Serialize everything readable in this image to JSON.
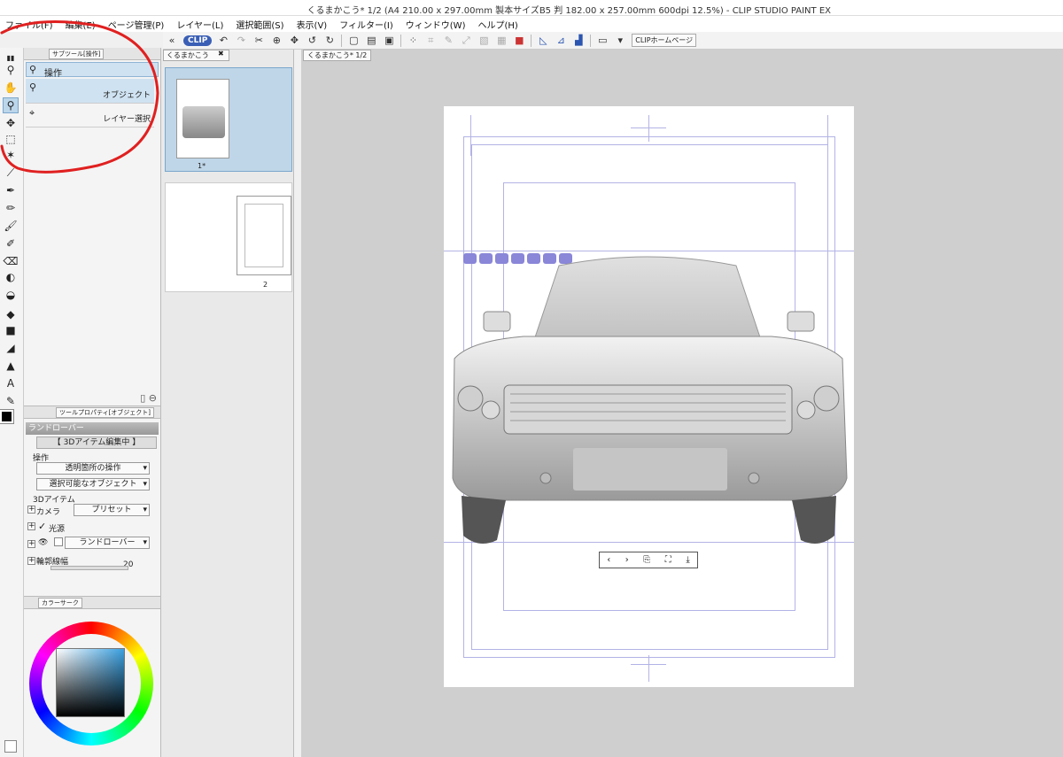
{
  "window": {
    "title": "くるまかこう* 1/2 (A4 210.00 x 297.00mm 製本サイズB5 判 182.00 x 257.00mm 600dpi 12.5%) - CLIP STUDIO PAINT EX"
  },
  "menu": [
    "ファイル(F)",
    "編集(E)",
    "ページ管理(P)",
    "レイヤー(L)",
    "選択範囲(S)",
    "表示(V)",
    "フィルター(I)",
    "ウィンドウ(W)",
    "ヘルプ(H)"
  ],
  "commandbar": {
    "clip_label": "CLIP",
    "home_label": "CLIPホームページ"
  },
  "subtool": {
    "tab_label": "サブツール[操作]",
    "group_label": "操作",
    "items": [
      {
        "label": "オブジェクト"
      },
      {
        "label": "レイヤー選択"
      }
    ]
  },
  "toolprop": {
    "tab_label": "ツールプロパティ[オブジェクト]",
    "object_name": "ランドローバー",
    "edit_status": "【 3Dアイテム編集中 】",
    "operation_label": "操作",
    "transparent_op": "透明箇所の操作",
    "selectable_obj": "選択可能なオブジェクト",
    "item3d_label": "3Dアイテム",
    "camera_label": "カメラ",
    "preset_label": "プリセット",
    "light_label": "光源",
    "model_label": "ランドローバー",
    "outline_label": "輪郭線幅",
    "outline_value": "20"
  },
  "color": {
    "tab_label": "カラーサーク",
    "hue_color": "#3aa0e0"
  },
  "pagemgr": {
    "tab_label": "くるまかこう",
    "pages": [
      {
        "number": "1*",
        "selected": true
      },
      {
        "number": "2",
        "selected": false
      }
    ]
  },
  "canvas": {
    "tab_label": "くるまかこう* 1/2"
  },
  "colors": {
    "accent": "#3a5fb5",
    "selection": "#cfe2f1",
    "guide": "#b3b3e6",
    "annotation": "#e02020"
  }
}
